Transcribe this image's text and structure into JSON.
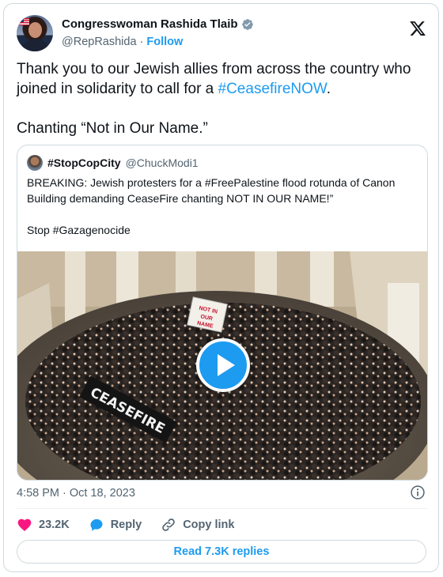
{
  "author": {
    "name": "Congresswoman Rashida Tlaib",
    "handle": "@RepRashida",
    "separator": "·",
    "follow_label": "Follow"
  },
  "tweet": {
    "line1_text": "Thank you to our Jewish allies from across the country who joined in solidarity to call for a ",
    "line1_hashtag": "#CeasefireNOW",
    "line1_end": ".",
    "line2": "Chanting “Not in Our Name.”"
  },
  "quoted": {
    "name": "#StopCopCity",
    "handle": "@ChuckModi1",
    "text": "BREAKING: Jewish protesters for a #FreePalestine flood rotunda of Canon Building demanding CeaseFire chanting NOT IN OUR NAME!”",
    "text2": "Stop #Gazagenocide",
    "banner_text": "CEASEFIRE",
    "sign_text": "NOT IN OUR NAME"
  },
  "meta": {
    "timestamp": "4:58 PM · Oct 18, 2023"
  },
  "actions": {
    "likes": "23.2K",
    "reply_label": "Reply",
    "copy_link_label": "Copy link",
    "read_replies_label": "Read 7.3K replies"
  },
  "colors": {
    "accent": "#1d9bf0",
    "like": "#f91880",
    "text": "#0f1419",
    "muted": "#536471",
    "border": "#cfd9de"
  },
  "icons": [
    "verified-badge-icon",
    "x-logo-icon",
    "play-icon",
    "info-icon",
    "heart-icon",
    "reply-icon",
    "link-icon"
  ]
}
